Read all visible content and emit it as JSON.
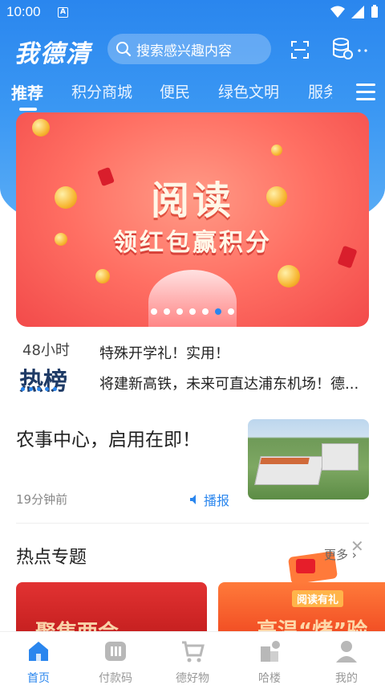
{
  "status_bar": {
    "time": "10:00",
    "app_badge": "A"
  },
  "header": {
    "logo": "我德清",
    "search_placeholder": "搜索感兴趣内容"
  },
  "tabs": [
    "推荐",
    "积分商城",
    "便民",
    "绿色文明",
    "服务"
  ],
  "banner": {
    "title": "阅读",
    "subtitle": "领红包赢积分",
    "dot_count": 7,
    "active_dot": 5
  },
  "hot_list": {
    "hours": "48小时",
    "label": "热榜",
    "items": [
      "特殊开学礼！实用！",
      "将建新高铁，未来可直达浦东机场！德..."
    ]
  },
  "news": {
    "headline": "农事中心，启用在即！",
    "time": "19分钟前",
    "play_label": "播报"
  },
  "topics": {
    "title": "热点专题",
    "more": "更多",
    "promo_label": "阅读有礼",
    "cards": [
      "聚焦两会",
      "高温“烤”验"
    ]
  },
  "bottom_nav": [
    "首页",
    "付款码",
    "德好物",
    "哈楼",
    "我的"
  ],
  "colors": {
    "brand_blue": "#2a86ee",
    "banner_red": "#f24a4a"
  }
}
